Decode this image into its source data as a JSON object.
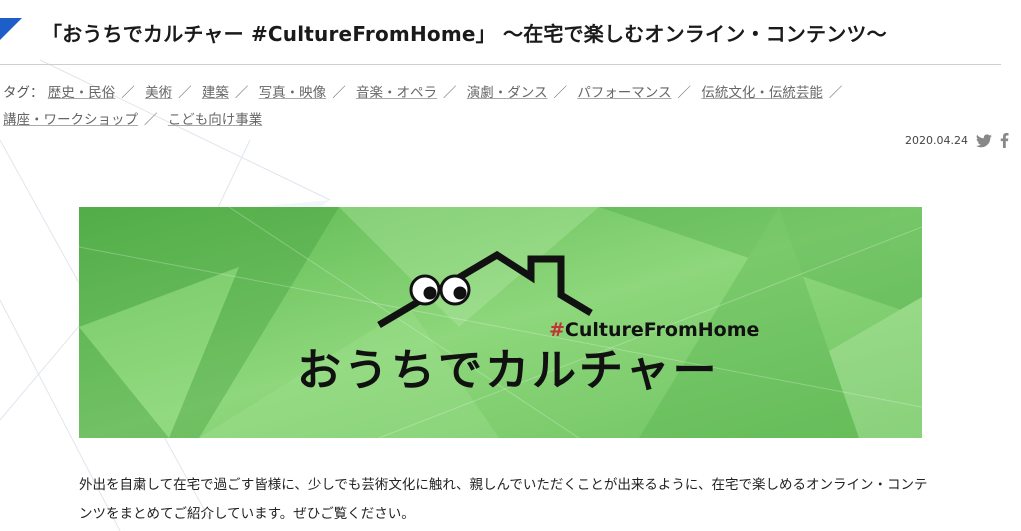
{
  "article": {
    "title": "「おうちでカルチャー #CultureFromHome」 ～在宅で楽しむオンライン・コンテンツ～",
    "tags_label": "タグ：",
    "tags": [
      "歴史・民俗",
      "美術",
      "建築",
      "写真・映像",
      "音楽・オペラ",
      "演劇・ダンス",
      "パフォーマンス",
      "伝統文化・伝統芸能",
      "講座・ワークショップ",
      "こども向け事業"
    ],
    "date": "2020.04.24",
    "share_icons": [
      "twitter-icon",
      "facebook-icon"
    ]
  },
  "banner": {
    "hashtag": "#CultureFromHome",
    "logo_text": "おうちでカルチャー",
    "colors": {
      "green_light": "#a6df94",
      "green_mid": "#7fcf6f",
      "green_dark": "#4fae45",
      "ink": "#111111",
      "hashtag_red": "#c53232"
    }
  },
  "intro_text": "外出を自粛して在宅で過ごす皆様に、少しでも芸術文化に触れ、親しんでいただくことが出来るように、在宅で楽しめるオンライン・コンテンツをまとめてご紹介しています。ぜひご覧ください。"
}
